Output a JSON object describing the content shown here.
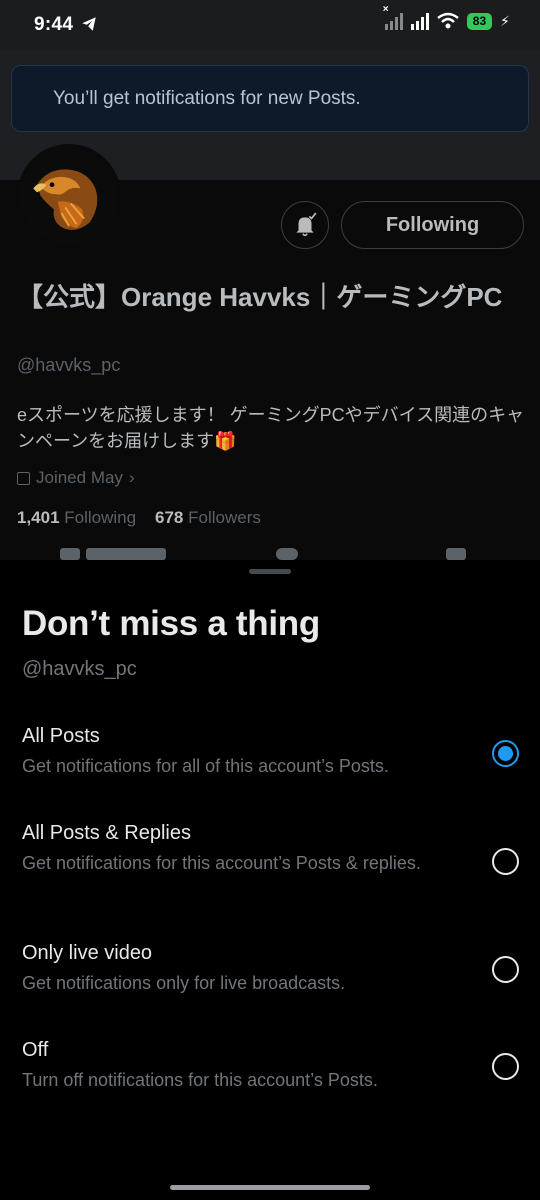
{
  "status_bar": {
    "time": "9:44",
    "battery": "83"
  },
  "toast": {
    "text": "You’ll get notifications for new Posts."
  },
  "profile": {
    "follow_button": "Following",
    "display_name": "【公式】Orange Havvks｜ゲーミングPC",
    "handle": "@havvks_pc",
    "bio": "eスポーツを応援します！ ゲーミングPCやデバイス関連のキャンペーンをお届けします🎁",
    "joined": "Joined May",
    "following_count": "1,401",
    "following_label": "Following",
    "followers_count": "678",
    "followers_label": "Followers"
  },
  "sheet": {
    "title": "Don’t miss a thing",
    "handle": "@havvks_pc",
    "options": [
      {
        "label": "All Posts",
        "description": "Get notifications for all of this account’s Posts.",
        "selected": true
      },
      {
        "label": "All Posts & Replies",
        "description": "Get notifications for this account’s Posts & replies.",
        "selected": false
      },
      {
        "label": "Only live video",
        "description": "Get notifications only for live broadcasts.",
        "selected": false
      },
      {
        "label": "Off",
        "description": "Turn off notifications for this account’s Posts.",
        "selected": false
      }
    ]
  },
  "colors": {
    "accent": "#1d9bf0",
    "battery": "#34c759"
  },
  "icons": [
    "telegram-icon",
    "signal-icon",
    "wifi-icon",
    "bell-icon",
    "calendar-icon",
    "chevron-right-icon"
  ]
}
